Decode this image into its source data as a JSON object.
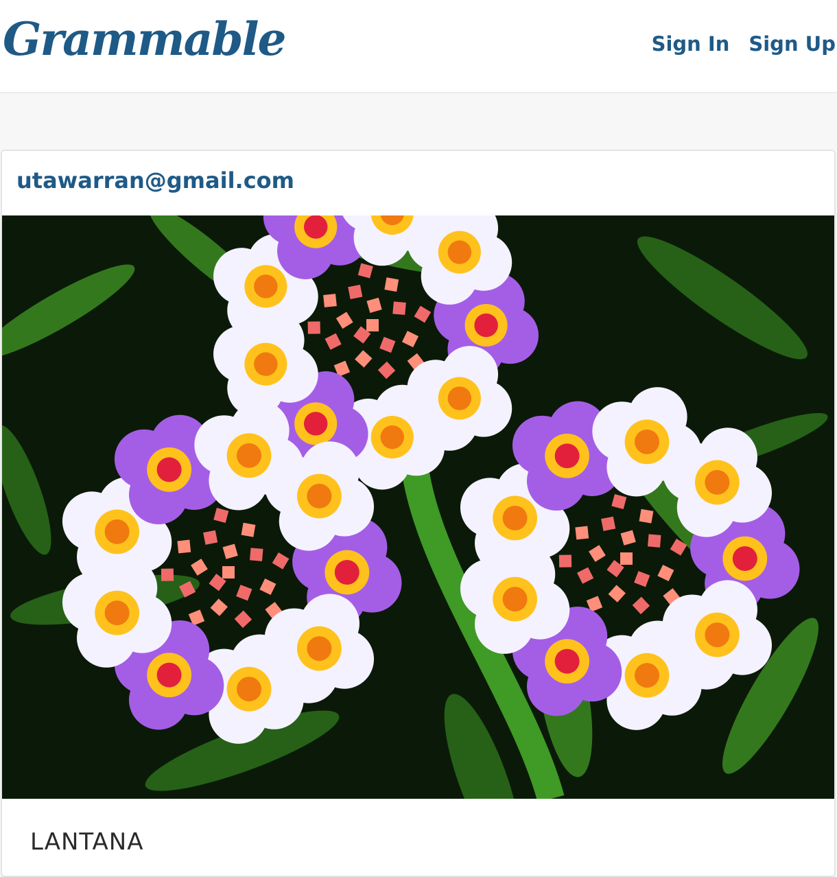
{
  "nav": {
    "brand": "Grammable",
    "links": [
      {
        "label": "Sign In"
      },
      {
        "label": "Sign Up"
      }
    ]
  },
  "post": {
    "author_email": "utawarran@gmail.com",
    "caption": "LANTANA",
    "image": {
      "subject": "lantana flower clusters",
      "colors": {
        "background": "#0b1a08",
        "leaf": "#3c8a22",
        "petal_purple": "#a45ee6",
        "petal_white": "#f4f2ff",
        "petal_yellow": "#ffc21c",
        "center_orange": "#f07a10",
        "center_red": "#e2203c",
        "bud_pink": "#f06a6a"
      }
    }
  },
  "theme": {
    "accent": "#1f5a87",
    "page_background": "#f7f7f7",
    "card_border": "#e4e4e4"
  }
}
